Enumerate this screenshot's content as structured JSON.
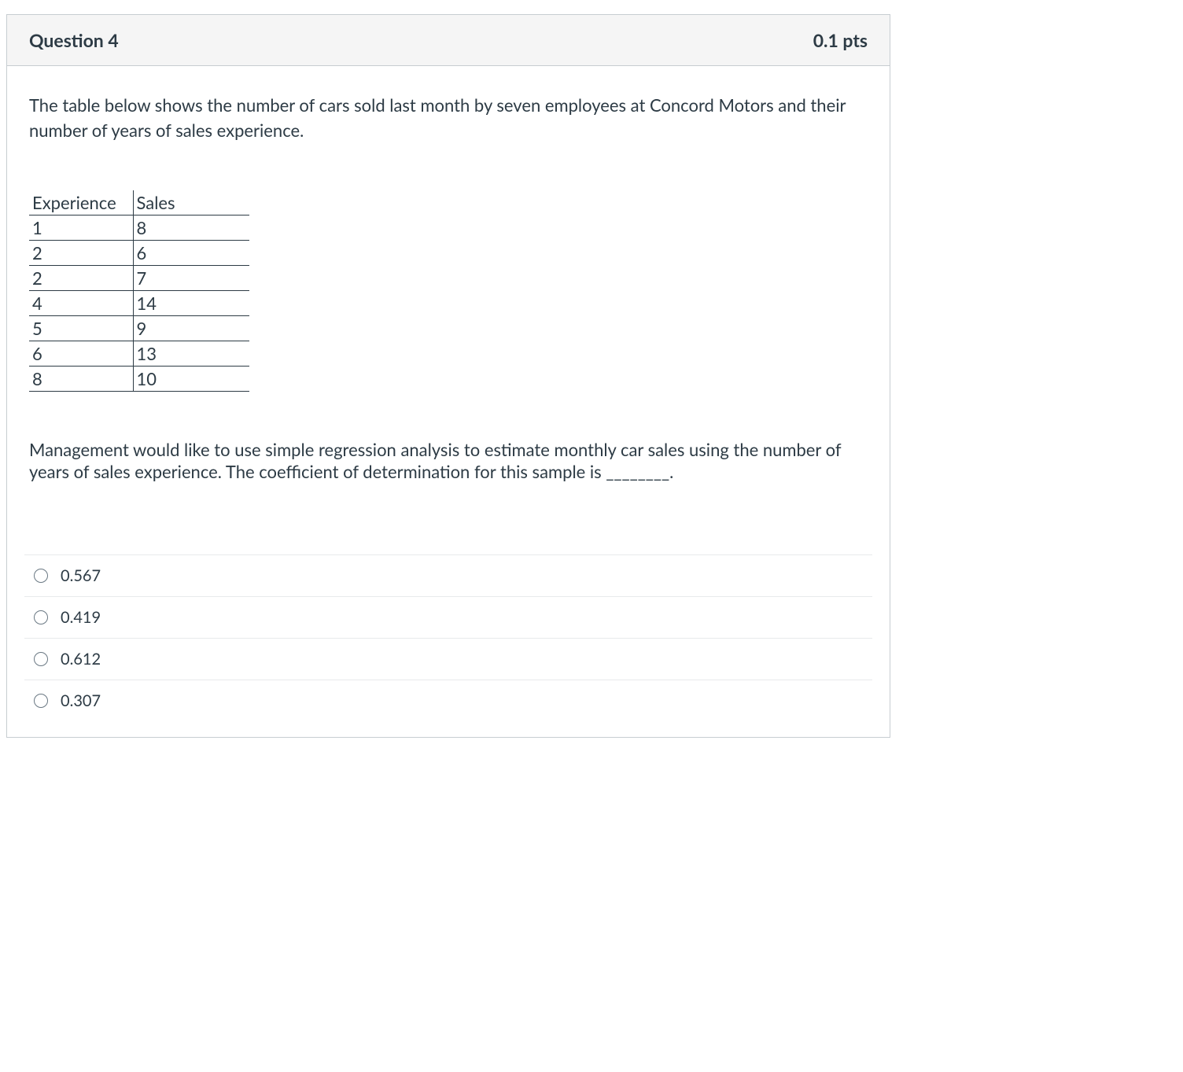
{
  "question": {
    "title": "Question 4",
    "points": "0.1 pts",
    "prompt": "The table below shows the number of cars sold last month by seven employees at Concord Motors and their number of years of sales experience.",
    "followup": "Management would like to use simple regression analysis to estimate monthly car sales using the number of years of sales experience. The coefficient of determination for this sample is ________."
  },
  "table": {
    "headers": [
      "Experience",
      "Sales"
    ],
    "rows": [
      {
        "experience": "1",
        "sales": "8"
      },
      {
        "experience": "2",
        "sales": "6"
      },
      {
        "experience": "2",
        "sales": "7"
      },
      {
        "experience": "4",
        "sales": "14"
      },
      {
        "experience": "5",
        "sales": "9"
      },
      {
        "experience": "6",
        "sales": "13"
      },
      {
        "experience": "8",
        "sales": "10"
      }
    ]
  },
  "answers": [
    {
      "label": "0.567"
    },
    {
      "label": "0.419"
    },
    {
      "label": "0.612"
    },
    {
      "label": "0.307"
    }
  ]
}
